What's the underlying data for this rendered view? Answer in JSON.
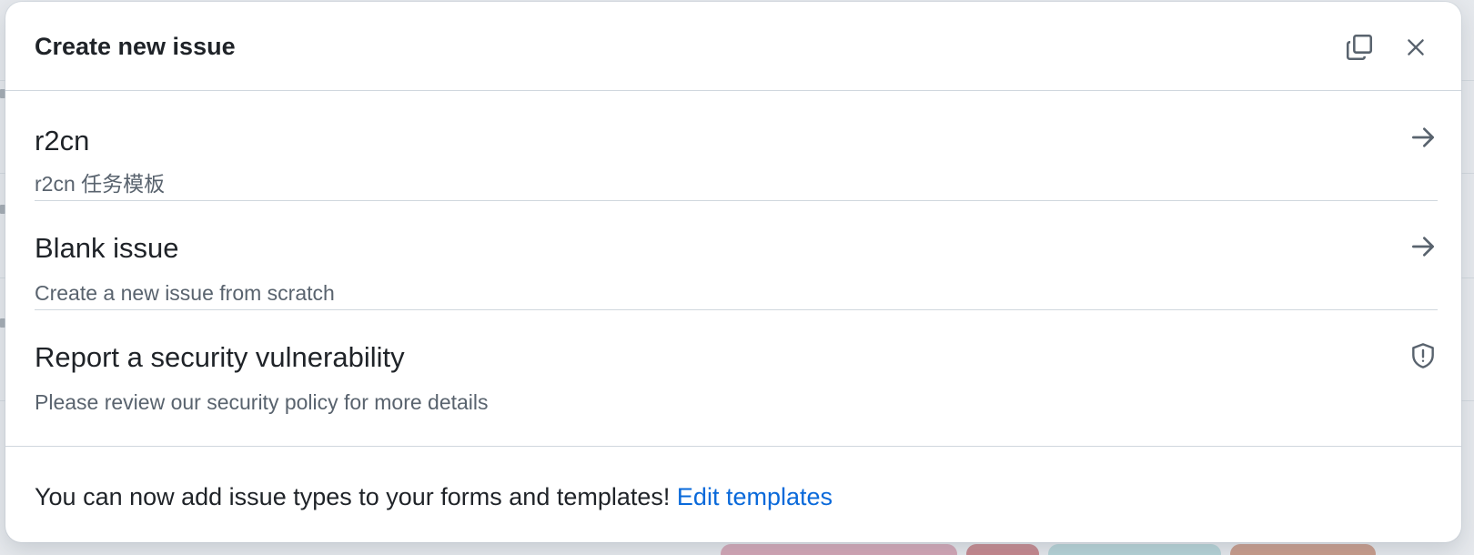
{
  "dialog": {
    "title": "Create new issue"
  },
  "templates": [
    {
      "title": "r2cn",
      "description": "r2cn 任务模板",
      "icon": "arrow-right-icon"
    },
    {
      "title": "Blank issue",
      "description": "Create a new issue from scratch",
      "icon": "arrow-right-icon"
    },
    {
      "title": "Report a security vulnerability",
      "description": "Please review our security policy for more details",
      "icon": "shield-alert-icon"
    }
  ],
  "footer": {
    "text": "You can now add issue types to your forms and templates!",
    "link_label": "Edit templates"
  },
  "colors": {
    "link": "#0969da",
    "muted_text": "#59636e",
    "border": "#d0d7de"
  }
}
